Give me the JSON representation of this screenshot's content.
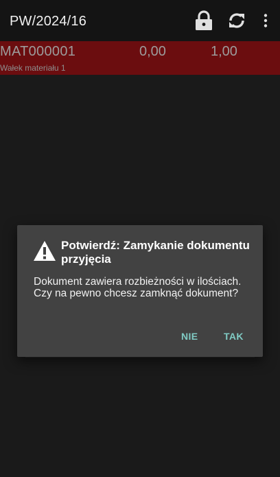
{
  "appbar": {
    "title": "PW/2024/16",
    "icons": [
      "lock-icon",
      "sync-icon",
      "more-vert-icon"
    ]
  },
  "list": {
    "rows": [
      {
        "code": "MAT000001",
        "value1": "0,00",
        "value2": "1,00",
        "description": "Wałek materiału 1"
      }
    ]
  },
  "dialog": {
    "icon": "warning-icon",
    "title": "Potwierdź: Zamykanie dokumentu przyjęcia",
    "message": "Dokument zawiera rozbieżności w ilościach. Czy na pewno chcesz zamknąć dokument?",
    "no_label": "NIE",
    "yes_label": "TAK"
  },
  "colors": {
    "background": "#1a1a1a",
    "appbar": "#141414",
    "row_highlight": "#6b0d0f",
    "dialog": "#424242",
    "dialog_button": "#80cbc4"
  }
}
